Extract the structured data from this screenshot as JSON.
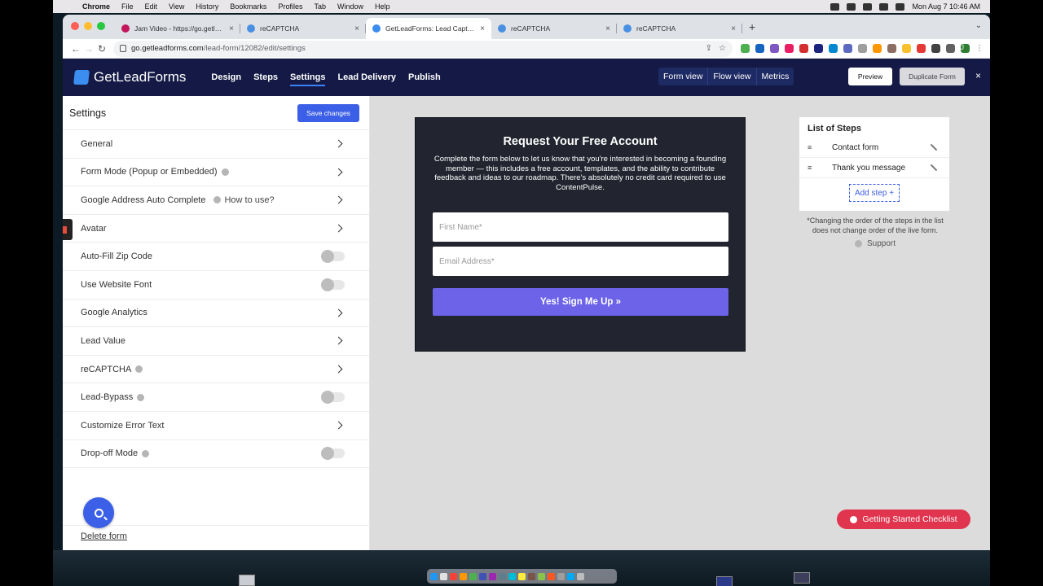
{
  "mac_menubar": {
    "app": "Chrome",
    "menus": [
      "File",
      "Edit",
      "View",
      "History",
      "Bookmarks",
      "Profiles",
      "Tab",
      "Window",
      "Help"
    ],
    "datetime": "Mon Aug 7  10:46 AM"
  },
  "browser": {
    "tabs": [
      {
        "title": "Jam Video - https://go.getlead",
        "favicon_color": "#c2185b"
      },
      {
        "title": "reCAPTCHA",
        "favicon_color": "#4a90e2"
      },
      {
        "title": "GetLeadForms: Lead Capture F",
        "favicon_color": "#3b8df0"
      },
      {
        "title": "reCAPTCHA",
        "favicon_color": "#4a90e2"
      },
      {
        "title": "reCAPTCHA",
        "favicon_color": "#4a90e2"
      }
    ],
    "url_host": "go.getleadforms.com",
    "url_path": "/lead-form/12082/edit/settings",
    "profile_initial": "J"
  },
  "app_header": {
    "brand": "GetLeadForms",
    "nav": [
      "Design",
      "Steps",
      "Settings",
      "Lead Delivery",
      "Publish"
    ],
    "active_nav": "Settings",
    "view_options": [
      "Form view",
      "Flow view",
      "Metrics"
    ],
    "preview_label": "Preview",
    "duplicate_label": "Duplicate Form",
    "close_label": "×"
  },
  "settings": {
    "title": "Settings",
    "save_label": "Save changes",
    "rows": [
      {
        "label": "General",
        "control": "chevron"
      },
      {
        "label": "Form Mode (Popup or Embedded)",
        "control": "chevron",
        "help": true
      },
      {
        "label": "Google Address Auto Complete",
        "control": "chevron",
        "help": true,
        "extra": "How to use?"
      },
      {
        "label": "Avatar",
        "control": "chevron"
      },
      {
        "label": "Auto-Fill Zip Code",
        "control": "toggle",
        "toggle_on": false
      },
      {
        "label": "Use Website Font",
        "control": "toggle",
        "toggle_on": false
      },
      {
        "label": "Google Analytics",
        "control": "chevron"
      },
      {
        "label": "Lead Value",
        "control": "chevron"
      },
      {
        "label": "reCAPTCHA",
        "control": "chevron",
        "help": true
      },
      {
        "label": "Lead-Bypass",
        "control": "toggle",
        "help": true,
        "toggle_on": false
      },
      {
        "label": "Customize Error Text",
        "control": "chevron"
      },
      {
        "label": "Drop-off Mode",
        "control": "toggle",
        "help": true,
        "toggle_on": false
      }
    ],
    "delete_label": "Delete form"
  },
  "form_preview": {
    "title": "Request Your Free Account",
    "description": "Complete the form below to let us know that you're interested in becoming a founding member — this includes a free account, templates, and the ability to contribute feedback and ideas to our roadmap. There's absolutely no credit card required to use ContentPulse.",
    "first_name_placeholder": "First Name*",
    "email_placeholder": "Email Address*",
    "submit_label": "Yes! Sign Me Up »"
  },
  "steps": {
    "title": "List of Steps",
    "items": [
      "Contact form",
      "Thank you message"
    ],
    "add_label": "Add step +",
    "note": "*Changing the order of the steps in the list does not change order of the live form.",
    "support_label": "Support"
  },
  "checklist_label": "Getting Started Checklist",
  "colors": {
    "header_bg": "#141a45",
    "primary": "#3b5fe6",
    "submit": "#6c63e8",
    "checklist": "#e0344f"
  }
}
